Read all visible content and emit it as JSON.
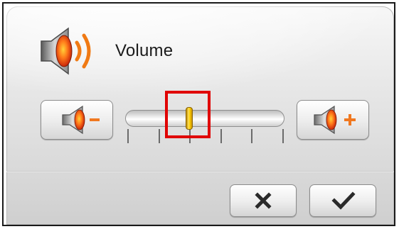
{
  "dialog": {
    "title": "Volume",
    "header_icon": "speaker-volume-icon"
  },
  "volume": {
    "level": 0.4,
    "tick_count": 6
  },
  "buttons": {
    "decrease_icon": "speaker-minus-icon",
    "increase_icon": "speaker-plus-icon",
    "cancel_icon": "close-x-icon",
    "confirm_icon": "check-icon"
  },
  "colors": {
    "highlight": "#e00000",
    "handle": "#ffd000",
    "sign": "#f07820",
    "speaker_cone": "#e03010"
  }
}
